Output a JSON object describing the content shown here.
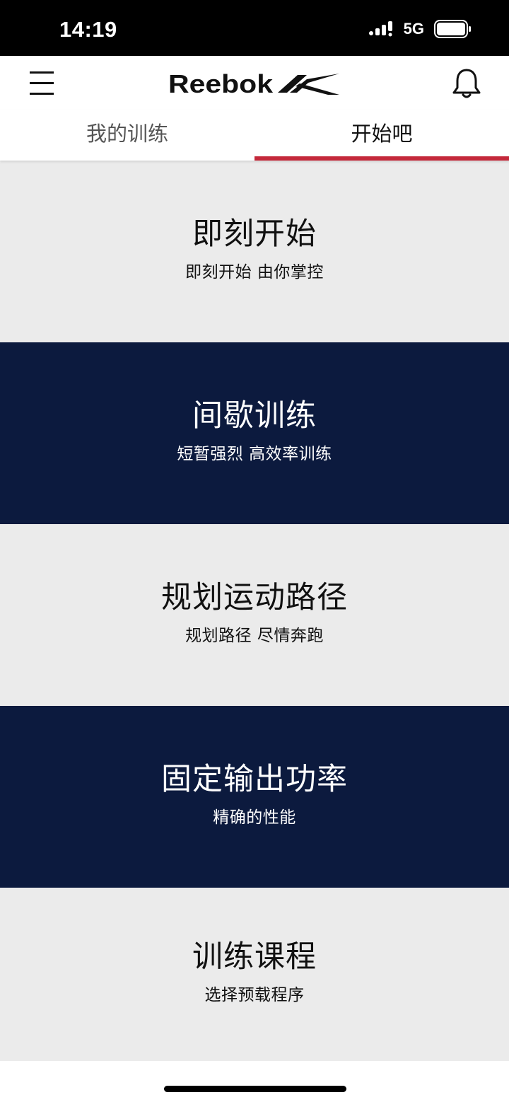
{
  "status_bar": {
    "time": "14:19",
    "network": "5G",
    "icons": [
      "signal-icon",
      "battery-icon"
    ]
  },
  "header": {
    "brand": "Reebok",
    "icons": [
      "hamburger-menu-icon",
      "reebok-logo",
      "bell-icon"
    ]
  },
  "tabs": [
    {
      "label": "我的训练",
      "active": false
    },
    {
      "label": "开始吧",
      "active": true
    }
  ],
  "workouts": [
    {
      "title": "即刻开始",
      "subtitle": "即刻开始 由你掌控",
      "theme": "light"
    },
    {
      "title": "间歇训练",
      "subtitle": "短暂强烈 高效率训练",
      "theme": "dark"
    },
    {
      "title": "规划运动路径",
      "subtitle": "规划路径 尽情奔跑",
      "theme": "light"
    },
    {
      "title": "固定输出功率",
      "subtitle": "精确的性能",
      "theme": "dark"
    },
    {
      "title": "训练课程",
      "subtitle": "选择预载程序",
      "theme": "light"
    }
  ],
  "colors": {
    "accent": "#c4283a",
    "dark_card": "#0c1a3e",
    "light_card": "#ebebeb"
  }
}
